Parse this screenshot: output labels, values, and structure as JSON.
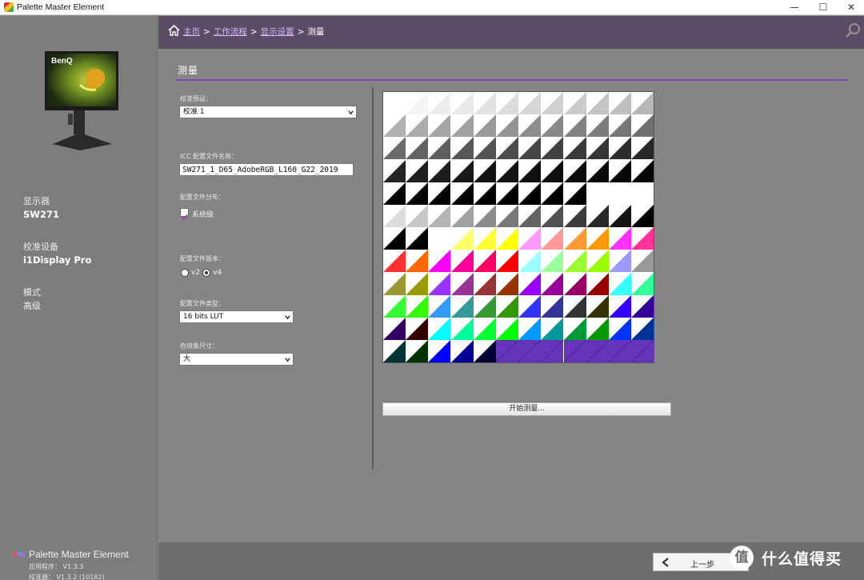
{
  "window": {
    "title": "Palette Master Element",
    "controls": {
      "minimize": "—",
      "maximize": "☐",
      "close": "✕"
    }
  },
  "sidebar": {
    "display_label": "显示器",
    "display_value": "SW271",
    "device_label": "校准设备",
    "device_value": "i1Display Pro",
    "mode_label": "模式",
    "mode_value": "高级",
    "brand_logo_text": "BenQ",
    "app_name": "Palette Master Element",
    "app_version": "应用程序：  V1.3.3",
    "engine_version": "校准器：  V1.3.2 (10182)"
  },
  "breadcrumb": {
    "home": "主页",
    "workflow": "工作流程",
    "display_settings": "显示设置",
    "current": "测量",
    "sep": ">"
  },
  "main": {
    "section_title": "测量",
    "calibration_preset_label": "校准预设：",
    "calibration_preset_value": "校准 1",
    "icc_name_label": "ICC 配置文件名称：",
    "icc_name_value": "SW271_1_D65_AdobeRGB_L160_G22_2019",
    "profile_dist_label": "配置文件分布：",
    "system_level_label": "系统级",
    "profile_version_label": "配置文件版本：",
    "v2_label": "v2",
    "v4_label": "v4",
    "selected_version": "v4",
    "profile_type_label": "配置文件类型：",
    "profile_type_value": "16 bits LUT",
    "patch_size_label": "色块集尺寸：",
    "patch_size_value": "大",
    "start_button": "开始测量..."
  },
  "patch_grid": {
    "cols": 12,
    "rows": 12,
    "patches": [
      [
        "#ffffff",
        "#f4f4f4",
        "#eeeeee",
        "#e8e8e8",
        "#e2e2e2",
        "#dcdcdc",
        "#d6d6d6",
        "#d0d0d0",
        "#cacaca",
        "#c4c4c4",
        "#bebebe",
        "#b8b8b8"
      ],
      [
        "#b2b2b2",
        "#acacac",
        "#a6a6a6",
        "#a0a0a0",
        "#9a9a9a",
        "#949494",
        "#8e8e8e",
        "#888888",
        "#828282",
        "#7c7c7c",
        "#767676",
        "#707070"
      ],
      [
        "#6a6a6a",
        "#646464",
        "#5e5e5e",
        "#585858",
        "#525252",
        "#4c4c4c",
        "#464646",
        "#404040",
        "#3a3a3a",
        "#343434",
        "#2e2e2e",
        "#282828"
      ],
      [
        "#242424",
        "#202020",
        "#1c1c1c",
        "#181818",
        "#141414",
        "#121212",
        "#101010",
        "#0e0e0e",
        "#0c0c0c",
        "#0a0a0a",
        "#080808",
        "#060606"
      ],
      [
        "#050505",
        "#040404",
        "#030303",
        "#020202",
        "#010101",
        "#000000",
        "#000000",
        "#000000",
        "#000000",
        "#ffffff",
        "#ffffff",
        "#ffffff"
      ],
      [
        "#dcdcdc",
        "#c8c8c8",
        "#b4b4b4",
        "#a0a0a0",
        "#8c8c8c",
        "#787878",
        "#646464",
        "#505050",
        "#3c3c3c",
        "#282828",
        "#141414",
        "#000000"
      ],
      [
        "#000000",
        "#000000",
        "#ffffff",
        "#ffff66",
        "#ffff33",
        "#ffff00",
        "#ff99ff",
        "#ff9999",
        "#ff9933",
        "#ff9900",
        "#ff33ff",
        "#ff3399"
      ],
      [
        "#ff3333",
        "#ff6600",
        "#ff00ff",
        "#ff0099",
        "#ff0066",
        "#ff0000",
        "#99ffff",
        "#99ff99",
        "#99ff33",
        "#99ff00",
        "#9999ff",
        "#999999"
      ],
      [
        "#999933",
        "#999900",
        "#9933ff",
        "#993399",
        "#993333",
        "#993300",
        "#9900ff",
        "#990099",
        "#990066",
        "#990000",
        "#33ffff",
        "#33ff99"
      ],
      [
        "#33ff33",
        "#33ff00",
        "#3399ff",
        "#339999",
        "#339933",
        "#339900",
        "#3333ff",
        "#333399",
        "#333333",
        "#333300",
        "#3300ff",
        "#330099"
      ],
      [
        "#330066",
        "#330000",
        "#00ffff",
        "#00ff99",
        "#00ff33",
        "#00ff00",
        "#0099ff",
        "#009999",
        "#009933",
        "#009900",
        "#0033ff",
        "#003399"
      ],
      [
        "#003333",
        "#003300",
        "#0000ff",
        "#000099",
        "#000033",
        "#6633bb",
        "#6633bb",
        "#6633bb",
        "#6633bb",
        "#6633bb",
        "#6633bb",
        "#6633bb"
      ]
    ],
    "pending_color": "#6633bb",
    "measured_count": 137
  },
  "footer": {
    "back_label": "上一步"
  },
  "watermark": {
    "symbol": "值",
    "text": "什么值得买"
  },
  "colors": {
    "accent": "#7a43c8",
    "header_bg": "#5a4d65",
    "link": "#d8b7ff"
  }
}
